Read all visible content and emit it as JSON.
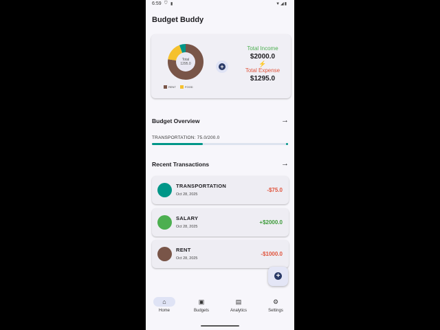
{
  "status_bar": {
    "time": "6:59"
  },
  "app": {
    "title": "Budget Buddy"
  },
  "summary": {
    "donut_center_line1": "Total",
    "donut_center_line2": "1295.0",
    "legend": [
      {
        "label": "RENT",
        "color": "#795548"
      },
      {
        "label": "FOOD",
        "color": "#f5c12e"
      }
    ],
    "segments": [
      {
        "value": 1000,
        "color": "#795548"
      },
      {
        "value": 220,
        "color": "#f5c12e"
      },
      {
        "value": 75,
        "color": "#009688"
      }
    ],
    "income_label": "Total Income",
    "income_value": "$2000.0",
    "expense_label": "Total Expense",
    "expense_value": "$1295.0"
  },
  "budget_overview": {
    "title": "Budget Overview",
    "item_label": "TRANSPORTATION: 75.0/200.0",
    "progress_fraction": 0.375
  },
  "recent": {
    "title": "Recent Transactions",
    "transactions": [
      {
        "name": "TRANSPORTATION",
        "date": "Oct 28, 2025",
        "amount": "-$75.0",
        "color": "#009688",
        "amount_color": "#e0533b"
      },
      {
        "name": "SALARY",
        "date": "Oct 28, 2025",
        "amount": "+$2000.0",
        "color": "#4caf50",
        "amount_color": "#3e9b3a"
      },
      {
        "name": "RENT",
        "date": "Oct 28, 2025",
        "amount": "-$1000.0",
        "color": "#795548",
        "amount_color": "#e0533b"
      }
    ]
  },
  "nav": {
    "items": [
      {
        "label": "Home",
        "icon": "home-icon"
      },
      {
        "label": "Budgets",
        "icon": "wallet-icon"
      },
      {
        "label": "Analytics",
        "icon": "chart-icon"
      },
      {
        "label": "Settings",
        "icon": "gear-icon"
      }
    ]
  }
}
